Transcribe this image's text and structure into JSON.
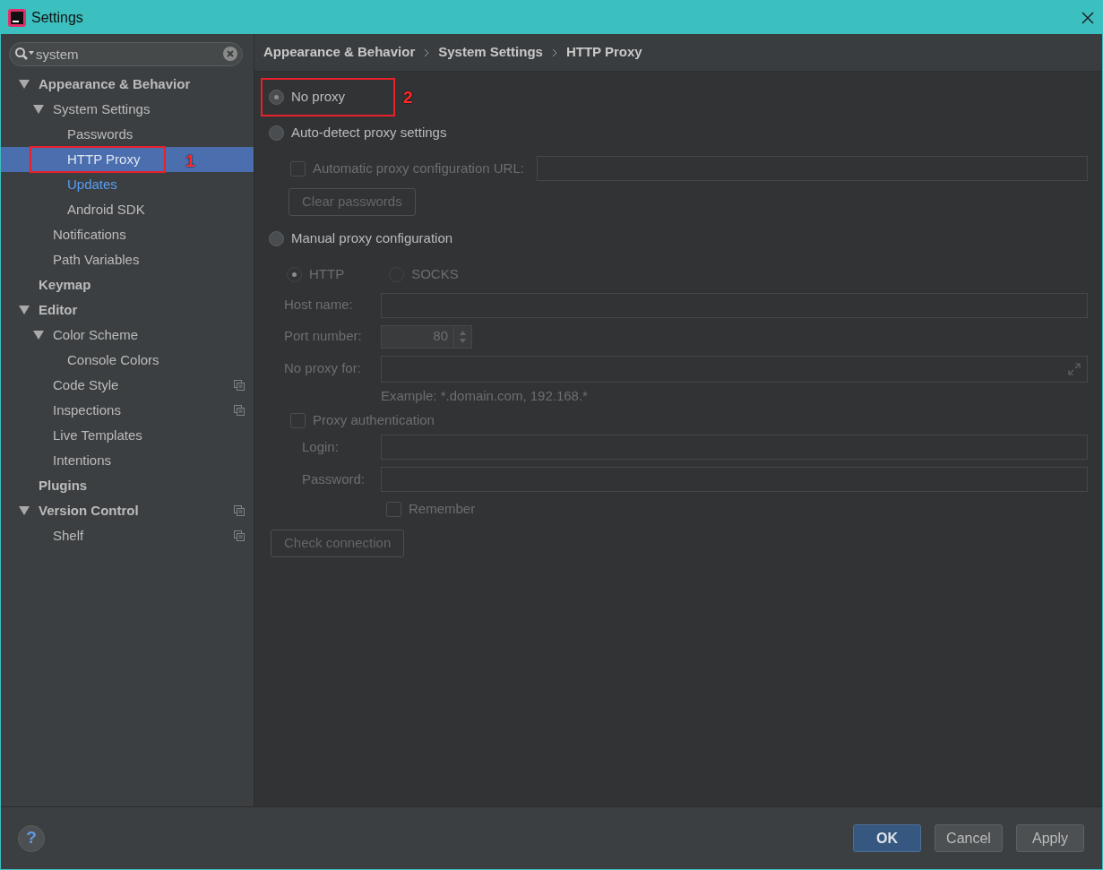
{
  "window": {
    "title": "Settings"
  },
  "search": {
    "value": "system"
  },
  "tree": [
    {
      "label": "Appearance & Behavior",
      "selected": false,
      "modified": false,
      "scope_icon": false,
      "expanded": true,
      "children": [
        {
          "label": "System Settings",
          "selected": false,
          "modified": false,
          "scope_icon": false,
          "expanded": true,
          "children": [
            {
              "label": "Passwords",
              "selected": false,
              "modified": false,
              "scope_icon": false
            },
            {
              "label": "HTTP Proxy",
              "selected": true,
              "modified": false,
              "scope_icon": false,
              "annotation": "1"
            },
            {
              "label": "Updates",
              "selected": false,
              "modified": true,
              "scope_icon": false
            },
            {
              "label": "Android SDK",
              "selected": false,
              "modified": false,
              "scope_icon": false
            }
          ]
        },
        {
          "label": "Notifications",
          "selected": false,
          "modified": false,
          "scope_icon": false
        },
        {
          "label": "Path Variables",
          "selected": false,
          "modified": false,
          "scope_icon": false
        }
      ]
    },
    {
      "label": "Keymap",
      "selected": false,
      "modified": false,
      "scope_icon": false
    },
    {
      "label": "Editor",
      "selected": false,
      "modified": false,
      "scope_icon": false,
      "expanded": true,
      "children": [
        {
          "label": "Color Scheme",
          "selected": false,
          "modified": false,
          "scope_icon": false,
          "expanded": true,
          "children": [
            {
              "label": "Console Colors",
              "selected": false,
              "modified": false,
              "scope_icon": false
            }
          ]
        },
        {
          "label": "Code Style",
          "selected": false,
          "modified": false,
          "scope_icon": true
        },
        {
          "label": "Inspections",
          "selected": false,
          "modified": false,
          "scope_icon": true
        },
        {
          "label": "Live Templates",
          "selected": false,
          "modified": false,
          "scope_icon": false
        },
        {
          "label": "Intentions",
          "selected": false,
          "modified": false,
          "scope_icon": false
        }
      ]
    },
    {
      "label": "Plugins",
      "selected": false,
      "modified": false,
      "scope_icon": false
    },
    {
      "label": "Version Control",
      "selected": false,
      "modified": false,
      "scope_icon": true,
      "expanded": true,
      "children": [
        {
          "label": "Shelf",
          "selected": false,
          "modified": false,
          "scope_icon": true
        }
      ]
    }
  ],
  "breadcrumb": [
    "Appearance & Behavior",
    "System Settings",
    "HTTP Proxy"
  ],
  "proxy_modes": [
    {
      "label": "No proxy",
      "selected": true,
      "disabled": false,
      "annotation": "2"
    },
    {
      "label": "Auto-detect proxy settings",
      "selected": false,
      "disabled": false
    },
    {
      "label": "Manual proxy configuration",
      "selected": false,
      "disabled": false
    }
  ],
  "auto_config": {
    "label": "Automatic proxy configuration URL:",
    "checked": false,
    "disabled": true
  },
  "clear_passwords": {
    "label": "Clear passwords",
    "disabled": true
  },
  "protocols": [
    {
      "label": "HTTP",
      "selected": true,
      "disabled": true
    },
    {
      "label": "SOCKS",
      "selected": false,
      "disabled": true
    }
  ],
  "fields": [
    {
      "label": "Host name:",
      "kind": "text",
      "disabled": true
    },
    {
      "label": "Port number:",
      "kind": "spinner",
      "value": "80",
      "disabled": true
    },
    {
      "label": "No proxy for:",
      "kind": "expandable",
      "disabled": true
    }
  ],
  "hint": "Example: *.domain.com, 192.168.*",
  "proxy_auth": {
    "label": "Proxy authentication",
    "checked": false,
    "disabled": true
  },
  "auth_fields": [
    {
      "label": "Login:",
      "disabled": true
    },
    {
      "label": "Password:",
      "disabled": true
    }
  ],
  "remember": {
    "label": "Remember",
    "checked": false,
    "disabled": true
  },
  "check_connection": {
    "label": "Check connection",
    "disabled": true
  },
  "help": {
    "label": "?"
  },
  "buttons": [
    {
      "label": "OK",
      "kind": "primary"
    },
    {
      "label": "Cancel",
      "kind": "default"
    },
    {
      "label": "Apply",
      "kind": "default"
    }
  ]
}
